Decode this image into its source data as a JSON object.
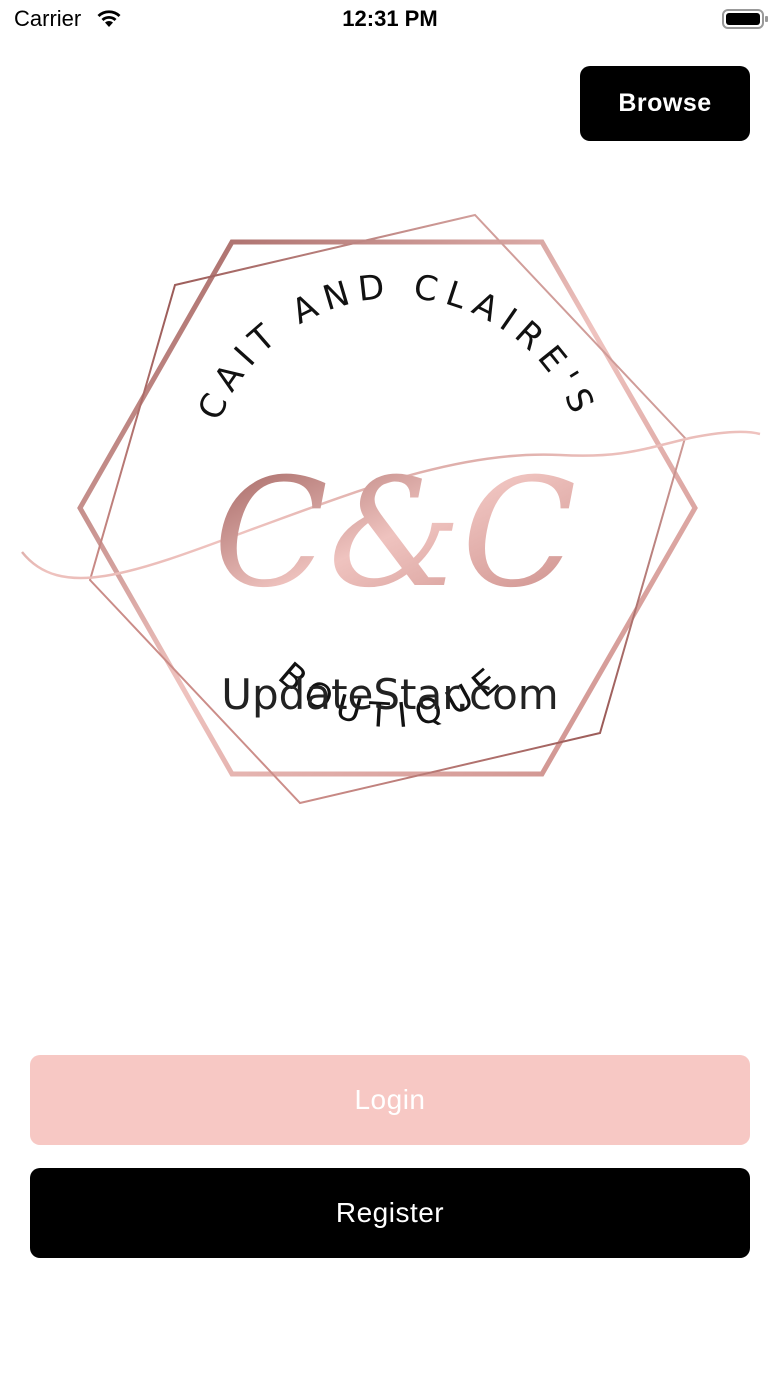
{
  "status_bar": {
    "carrier": "Carrier",
    "time": "12:31 PM",
    "icons": [
      "wifi-icon",
      "battery-icon"
    ]
  },
  "header": {
    "browse_label": "Browse"
  },
  "logo": {
    "top_text": "CAIT AND CLAIRE'S",
    "monogram": "C&C",
    "bottom_text": "BOUTIQUE",
    "colors": {
      "rose_gold": "#c98a86",
      "rose_gold_dark": "#9b5b58",
      "rose_gold_light": "#efc3bf",
      "text": "#111111"
    }
  },
  "watermark": {
    "text": "UpdateStar.com"
  },
  "actions": {
    "login_label": "Login",
    "register_label": "Register"
  },
  "colors": {
    "login_bg": "#f7c8c4",
    "register_bg": "#000000",
    "browse_bg": "#000000"
  }
}
